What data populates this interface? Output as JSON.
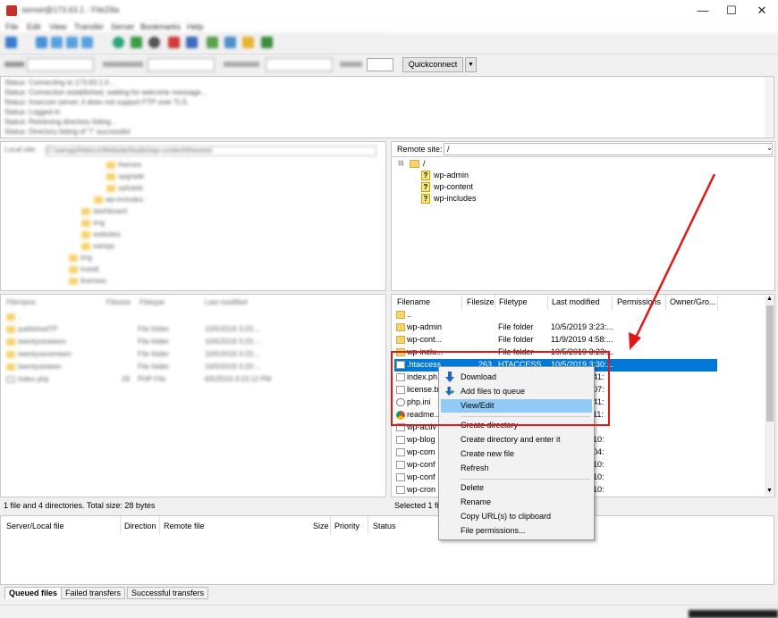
{
  "window": {
    "title": "sensei@173.63.1 - FileZilla",
    "controls": [
      "—",
      "☐",
      "✕"
    ]
  },
  "menu": [
    "File",
    "Edit",
    "View",
    "Transfer",
    "Server",
    "Bookmarks",
    "Help"
  ],
  "quickconnect": {
    "button": "Quickconnect",
    "dropdown": "▼"
  },
  "log": [
    "Status:        Connecting to 173.63.1.0...",
    "Status:        Connection established, waiting for welcome message...",
    "Status:        Insecure server, it does not support FTP over TLS.",
    "Status:        Logged in",
    "Status:        Retrieving directory listing...",
    "Status:        Directory listing of \"/\" successful"
  ],
  "local": {
    "site_label": "Local site:",
    "site_path": "C:\\xampp\\htdocs\\WebsiteStudio\\wp-content\\themes\\",
    "tree": [
      "themes",
      "upgrade",
      "uploads",
      "wp-includes",
      "dashboard",
      "img",
      "websites",
      "xampp",
      "img",
      "install",
      "licenses"
    ],
    "headers": [
      "Filename",
      "Filesize",
      "Filetype",
      "Last modified"
    ],
    "files": [
      {
        "name": "..",
        "size": "",
        "type": "",
        "modified": ""
      },
      {
        "name": "publishedTP",
        "size": "",
        "type": "File folder",
        "modified": "10/5/2019 3:23:..."
      },
      {
        "name": "twentynineteen",
        "size": "",
        "type": "File folder",
        "modified": "10/5/2019 3:23:..."
      },
      {
        "name": "twentyseventeen",
        "size": "",
        "type": "File folder",
        "modified": "10/5/2019 3:23:..."
      },
      {
        "name": "twentysixteen",
        "size": "",
        "type": "File folder",
        "modified": "10/5/2019 3:23:..."
      },
      {
        "name": "index.php",
        "size": "28",
        "type": "PHP File",
        "modified": "6/5/2019 3:23:12 PM"
      }
    ],
    "status": "1 file and 4 directories. Total size: 28 bytes"
  },
  "remote": {
    "site_label": "Remote site:",
    "site_path": "/",
    "tree_root": "/",
    "tree": [
      "wp-admin",
      "wp-content",
      "wp-includes"
    ],
    "headers": [
      "Filename",
      "Filesize",
      "Filetype",
      "Last modified",
      "Permissions",
      "Owner/Gro..."
    ],
    "files": [
      {
        "name": "..",
        "size": "",
        "type": "",
        "modified": "",
        "icon": "folder"
      },
      {
        "name": "wp-admin",
        "size": "",
        "type": "File folder",
        "modified": "10/5/2019 3:23:...",
        "icon": "folder"
      },
      {
        "name": "wp-cont...",
        "size": "",
        "type": "File folder",
        "modified": "11/9/2019 4:58:...",
        "icon": "folder"
      },
      {
        "name": "wp-inclu...",
        "size": "",
        "type": "File folder",
        "modified": "10/5/2019 3:23:...",
        "icon": "folder"
      },
      {
        "name": ".htaccess",
        "size": "263",
        "type": "HTACCESS...",
        "modified": "10/5/2019 3:30:...",
        "icon": "file"
      },
      {
        "name": "index.ph",
        "size": "",
        "type": "",
        "modified": "41:",
        "icon": "file"
      },
      {
        "name": "license.b",
        "size": "",
        "type": "",
        "modified": "07:",
        "icon": "file"
      },
      {
        "name": "php.ini",
        "size": "",
        "type": "",
        "modified": "41:",
        "icon": "php"
      },
      {
        "name": "readme...",
        "size": "",
        "type": "",
        "modified": "11:",
        "icon": "chrome"
      },
      {
        "name": "wp-activ",
        "size": "",
        "type": "",
        "modified": "",
        "icon": "file"
      },
      {
        "name": "wp-blog",
        "size": "",
        "type": "",
        "modified": "10:",
        "icon": "file"
      },
      {
        "name": "wp-com",
        "size": "",
        "type": "",
        "modified": "04:",
        "icon": "file"
      },
      {
        "name": "wp-conf",
        "size": "",
        "type": "",
        "modified": "10:",
        "icon": "file"
      },
      {
        "name": "wp-conf",
        "size": "",
        "type": "",
        "modified": "10:",
        "icon": "file"
      },
      {
        "name": "wp-cron",
        "size": "",
        "type": "",
        "modified": "10:",
        "icon": "file"
      }
    ],
    "status": "Selected 1 fil"
  },
  "context_menu": {
    "items": [
      {
        "label": "Download",
        "icon": "download-arrow-icon"
      },
      {
        "label": "Add files to queue",
        "icon": "add-queue-icon"
      },
      {
        "label": "View/Edit",
        "icon": ""
      },
      {
        "label": "Create directory",
        "icon": ""
      },
      {
        "label": "Create directory and enter it",
        "icon": ""
      },
      {
        "label": "Create new file",
        "icon": ""
      },
      {
        "label": "Refresh",
        "icon": ""
      },
      {
        "label": "Delete",
        "icon": ""
      },
      {
        "label": "Rename",
        "icon": ""
      },
      {
        "label": "Copy URL(s) to clipboard",
        "icon": ""
      },
      {
        "label": "File permissions...",
        "icon": ""
      }
    ],
    "highlighted": "View/Edit"
  },
  "queue": {
    "headers": [
      "Server/Local file",
      "Direction",
      "Remote file",
      "Size",
      "Priority",
      "Status"
    ],
    "tabs": [
      "Queued files",
      "Failed transfers",
      "Successful transfers"
    ]
  },
  "colors": {
    "selection": "#0078d7",
    "menu_highlight": "#91c9f7",
    "annotation": "#e01818"
  }
}
